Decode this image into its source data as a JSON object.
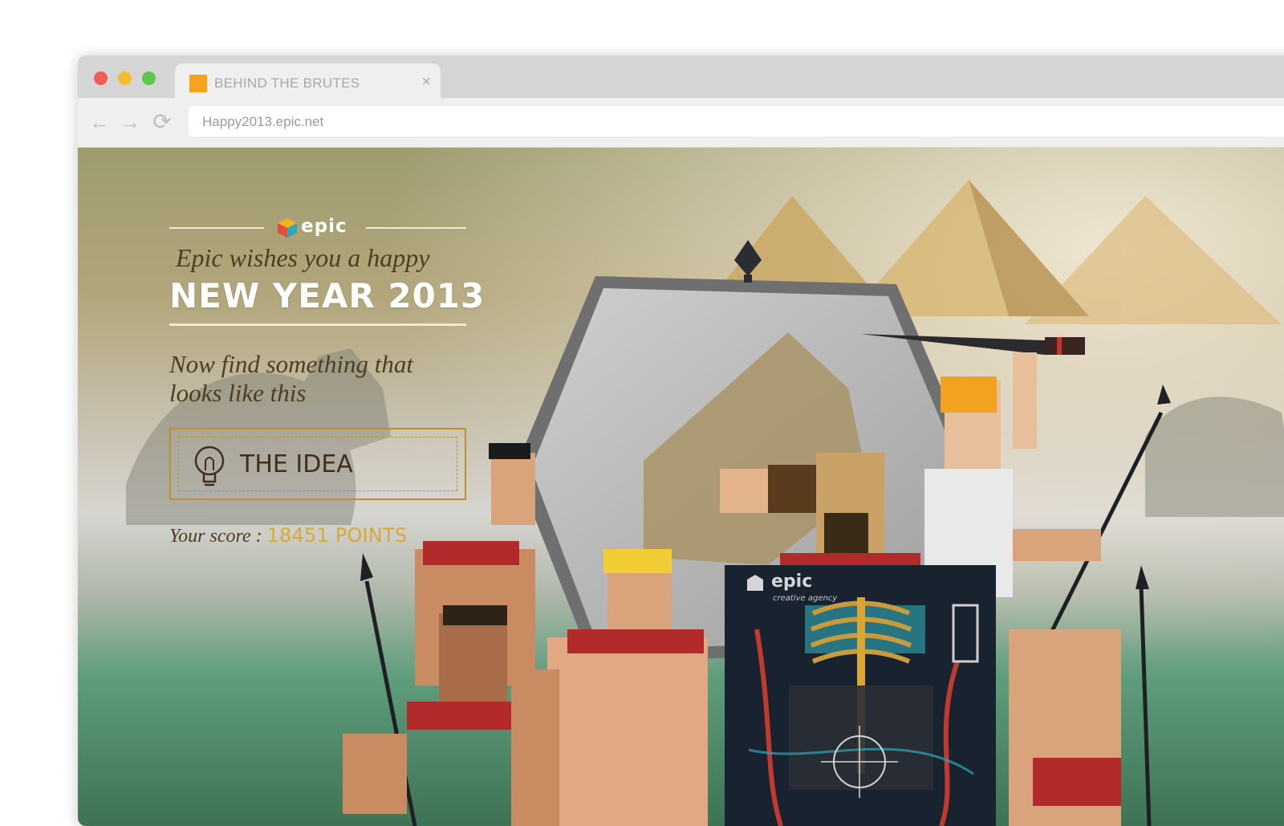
{
  "browser": {
    "tab_title": "BEHIND THE BRUTES",
    "tab_close": "×",
    "url": "Happy2013.epic.net",
    "nav": {
      "back": "←",
      "forward": "→",
      "reload": "⟳"
    }
  },
  "page": {
    "logo_text": "epic",
    "greeting": "Epic wishes you a happy",
    "headline": "NEW YEAR 2013",
    "prompt": "Now find something that looks like this",
    "hint_button": "THE IDEA",
    "score_label": "Your score :",
    "score_value": "18451 POINTS",
    "poster_logo": "epic",
    "poster_tagline": "creative agency"
  },
  "colors": {
    "tab_favicon": "#f7a31c",
    "accent_gold": "#d7a935",
    "frame_gold": "#b8932f",
    "text_brown": "#4c3d23"
  }
}
